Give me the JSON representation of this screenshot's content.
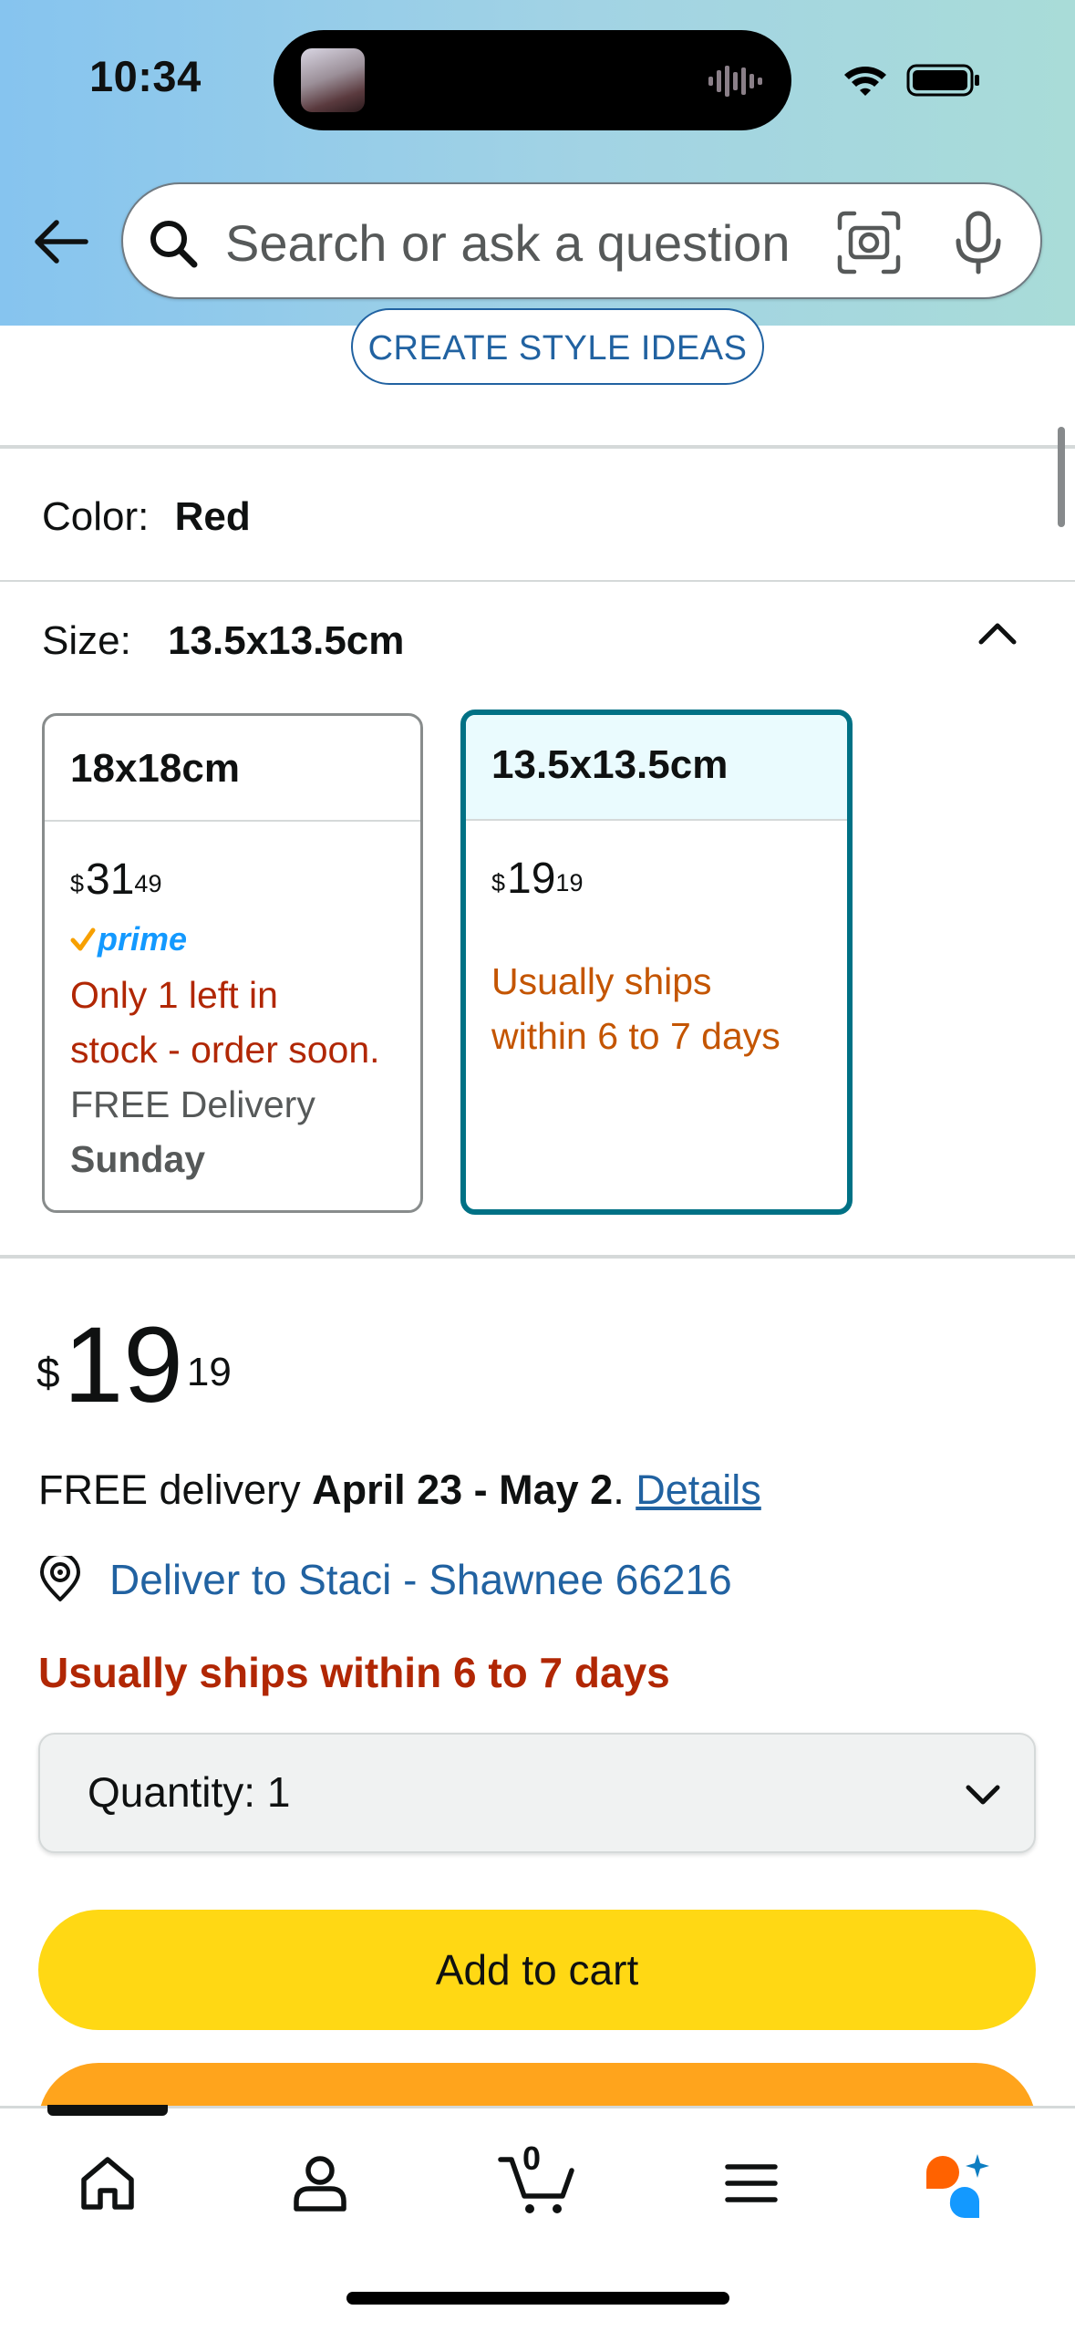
{
  "status_bar": {
    "time": "10:34"
  },
  "search": {
    "placeholder": "Search or ask a question"
  },
  "style_ideas_button": "CREATE STYLE IDEAS",
  "color": {
    "label": "Color:",
    "value": "Red"
  },
  "size": {
    "label": "Size:",
    "value": "13.5x13.5cm",
    "options": [
      {
        "name": "18x18cm",
        "price_dollars": "31",
        "price_cents": "49",
        "currency": "$",
        "prime": "prime",
        "stock_line1": "Only 1 left in",
        "stock_line2": "stock - order soon.",
        "delivery_line1": "FREE Delivery",
        "delivery_day": "Sunday"
      },
      {
        "name": "13.5x13.5cm",
        "price_dollars": "19",
        "price_cents": "19",
        "currency": "$",
        "ships_line1": "Usually ships",
        "ships_line2": "within 6 to 7 days"
      }
    ]
  },
  "price": {
    "currency": "$",
    "dollars": "19",
    "cents": "19"
  },
  "delivery": {
    "prefix": "FREE delivery ",
    "dates": "April 23 - May 2",
    "suffix": ". ",
    "details_link": "Details"
  },
  "deliver_to": "Deliver to Staci - Shawnee 66216",
  "availability": "Usually ships within 6 to 7 days",
  "quantity": {
    "label": "Quantity:",
    "value": "1"
  },
  "add_to_cart": "Add to cart",
  "bottom_nav": {
    "cart_count": "0"
  },
  "colors": {
    "link": "#2162a1",
    "selected_border": "#007185",
    "stock_red": "#b12704",
    "ships_orange": "#c45500",
    "add_to_cart": "#ffd814",
    "buy_now": "#ffa41c",
    "prime_blue": "#1399ff"
  },
  "icons": [
    "back-arrow-icon",
    "search-icon",
    "camera-lens-icon",
    "microphone-icon",
    "chevron-up-icon",
    "location-pin-icon",
    "chevron-down-icon",
    "home-icon",
    "profile-icon",
    "cart-icon",
    "menu-icon",
    "rufus-ai-icon"
  ]
}
